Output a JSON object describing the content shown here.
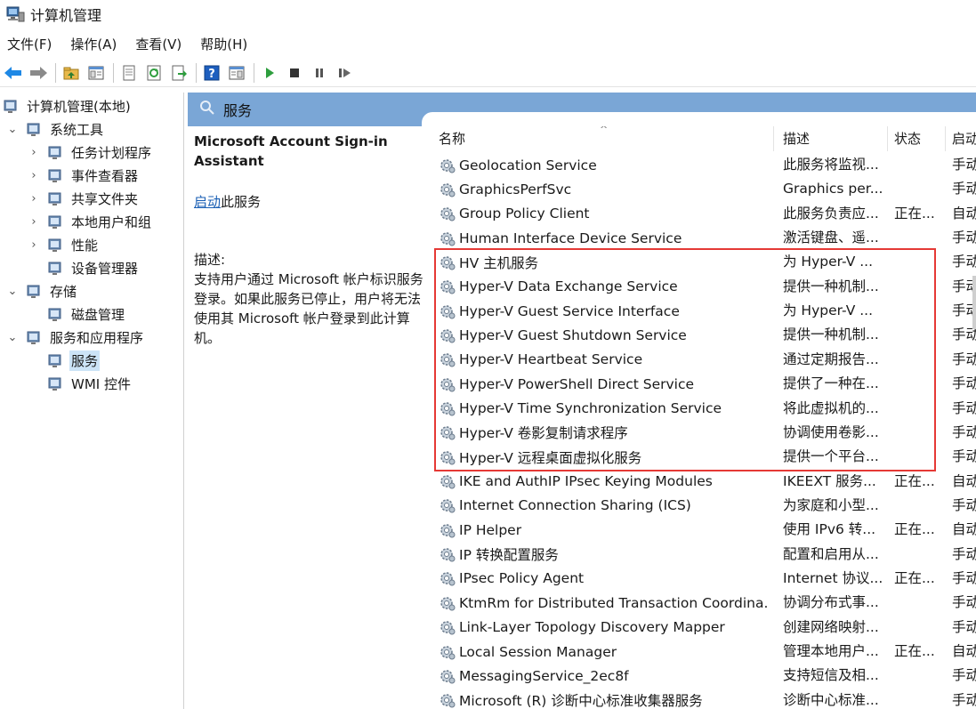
{
  "window": {
    "title": "计算机管理"
  },
  "menu": {
    "items": [
      "文件(F)",
      "操作(A)",
      "查看(V)",
      "帮助(H)"
    ]
  },
  "toolbar": {
    "buttons": [
      {
        "name": "back-button",
        "icon": "arrow-left-icon"
      },
      {
        "name": "forward-button",
        "icon": "arrow-right-icon"
      },
      {
        "name": "up-folder-button",
        "icon": "folder-up-icon"
      },
      {
        "name": "show-hide-tree-button",
        "icon": "console-tree-icon"
      },
      {
        "name": "properties-button",
        "icon": "properties-icon"
      },
      {
        "name": "refresh-button",
        "icon": "refresh-icon"
      },
      {
        "name": "export-list-button",
        "icon": "export-icon"
      },
      {
        "name": "help-button",
        "icon": "help-icon"
      },
      {
        "name": "show-action-pane-button",
        "icon": "action-pane-icon"
      },
      {
        "name": "start-service-button",
        "icon": "play-icon"
      },
      {
        "name": "stop-service-button",
        "icon": "stop-icon"
      },
      {
        "name": "pause-service-button",
        "icon": "pause-icon"
      },
      {
        "name": "restart-service-button",
        "icon": "restart-icon"
      }
    ]
  },
  "tree": {
    "items": [
      {
        "label": "计算机管理(本地)",
        "level": 0,
        "chevron": "",
        "icon": "computer-management-icon"
      },
      {
        "label": "系统工具",
        "level": 1,
        "chevron": "expanded",
        "icon": "system-tools-icon"
      },
      {
        "label": "任务计划程序",
        "level": 2,
        "chevron": "collapsed",
        "icon": "task-scheduler-icon"
      },
      {
        "label": "事件查看器",
        "level": 2,
        "chevron": "collapsed",
        "icon": "event-viewer-icon"
      },
      {
        "label": "共享文件夹",
        "level": 2,
        "chevron": "collapsed",
        "icon": "shared-folders-icon"
      },
      {
        "label": "本地用户和组",
        "level": 2,
        "chevron": "collapsed",
        "icon": "local-users-icon"
      },
      {
        "label": "性能",
        "level": 2,
        "chevron": "collapsed",
        "icon": "performance-icon"
      },
      {
        "label": "设备管理器",
        "level": 2,
        "chevron": "",
        "icon": "device-manager-icon"
      },
      {
        "label": "存储",
        "level": 1,
        "chevron": "expanded",
        "icon": "storage-icon"
      },
      {
        "label": "磁盘管理",
        "level": 2,
        "chevron": "",
        "icon": "disk-management-icon"
      },
      {
        "label": "服务和应用程序",
        "level": 1,
        "chevron": "expanded",
        "icon": "services-apps-icon"
      },
      {
        "label": "服务",
        "level": 2,
        "chevron": "",
        "icon": "services-icon",
        "selected": true
      },
      {
        "label": "WMI 控件",
        "level": 2,
        "chevron": "",
        "icon": "wmi-control-icon"
      }
    ]
  },
  "services_header": {
    "title": "服务"
  },
  "detail": {
    "service_name": "Microsoft Account Sign-in Assistant",
    "start_link": "启动",
    "start_suffix": "此服务",
    "description_label": "描述:",
    "description": "支持用户通过 Microsoft 帐户标识服务登录。如果此服务已停止，用户将无法使用其 Microsoft 帐户登录到此计算机。"
  },
  "columns": {
    "name": "名称",
    "description": "描述",
    "status": "状态",
    "startup": "启动"
  },
  "services": [
    {
      "name": "Geolocation Service",
      "description": "此服务将监视...",
      "status": "",
      "startup": "手动"
    },
    {
      "name": "GraphicsPerfSvc",
      "description": "Graphics per...",
      "status": "",
      "startup": "手动"
    },
    {
      "name": "Group Policy Client",
      "description": "此服务负责应...",
      "status": "正在...",
      "startup": "自动"
    },
    {
      "name": "Human Interface Device Service",
      "description": "激活键盘、遥...",
      "status": "",
      "startup": "手动"
    },
    {
      "name": "HV 主机服务",
      "description": "为 Hyper-V ...",
      "status": "",
      "startup": "手动"
    },
    {
      "name": "Hyper-V Data Exchange Service",
      "description": "提供一种机制...",
      "status": "",
      "startup": "手动"
    },
    {
      "name": "Hyper-V Guest Service Interface",
      "description": "为 Hyper-V ...",
      "status": "",
      "startup": "手动"
    },
    {
      "name": "Hyper-V Guest Shutdown Service",
      "description": "提供一种机制...",
      "status": "",
      "startup": "手动"
    },
    {
      "name": "Hyper-V Heartbeat Service",
      "description": "通过定期报告...",
      "status": "",
      "startup": "手动"
    },
    {
      "name": "Hyper-V PowerShell Direct Service",
      "description": "提供了一种在...",
      "status": "",
      "startup": "手动"
    },
    {
      "name": "Hyper-V Time Synchronization Service",
      "description": "将此虚拟机的...",
      "status": "",
      "startup": "手动"
    },
    {
      "name": "Hyper-V 卷影复制请求程序",
      "description": "协调使用卷影...",
      "status": "",
      "startup": "手动"
    },
    {
      "name": "Hyper-V 远程桌面虚拟化服务",
      "description": "提供一个平台...",
      "status": "",
      "startup": "手动"
    },
    {
      "name": "IKE and AuthIP IPsec Keying Modules",
      "description": "IKEEXT 服务...",
      "status": "正在...",
      "startup": "自动"
    },
    {
      "name": "Internet Connection Sharing (ICS)",
      "description": "为家庭和小型...",
      "status": "",
      "startup": "手动"
    },
    {
      "name": "IP Helper",
      "description": "使用 IPv6 转...",
      "status": "正在...",
      "startup": "自动"
    },
    {
      "name": "IP 转换配置服务",
      "description": "配置和启用从...",
      "status": "",
      "startup": "手动"
    },
    {
      "name": "IPsec Policy Agent",
      "description": "Internet 协议...",
      "status": "正在...",
      "startup": "手动"
    },
    {
      "name": "KtmRm for Distributed Transaction Coordina...",
      "description": "协调分布式事...",
      "status": "",
      "startup": "手动"
    },
    {
      "name": "Link-Layer Topology Discovery Mapper",
      "description": "创建网络映射...",
      "status": "",
      "startup": "手动"
    },
    {
      "name": "Local Session Manager",
      "description": "管理本地用户...",
      "status": "正在...",
      "startup": "自动"
    },
    {
      "name": "MessagingService_2ec8f",
      "description": "支持短信及相...",
      "status": "",
      "startup": "手动"
    },
    {
      "name": "Microsoft (R) 诊断中心标准收集器服务",
      "description": "诊断中心标准...",
      "status": "",
      "startup": "手动"
    }
  ]
}
